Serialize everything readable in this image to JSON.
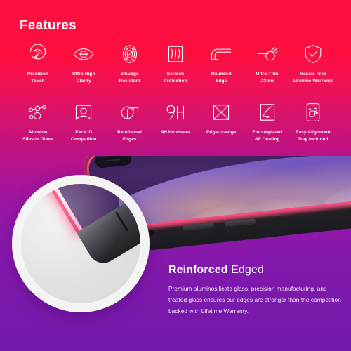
{
  "header": {
    "title": "Features"
  },
  "features": {
    "row1": [
      {
        "label": "Precision\nTouch",
        "icon": "precision-touch-icon"
      },
      {
        "label": "Ultra-High\nClarity",
        "icon": "eye-clarity-icon"
      },
      {
        "label": "Smudge\nResistant",
        "icon": "smudge-resistant-icon"
      },
      {
        "label": "Scratch\nProtection",
        "icon": "scratch-protection-icon"
      },
      {
        "label": "Rounded\nEdge",
        "icon": "rounded-edge-icon"
      },
      {
        "label": "Ultra-Thin\n.33mm",
        "icon": "ultra-thin-caliper-icon"
      },
      {
        "label": "Hassle Free\nLifetime Warranty",
        "icon": "shield-check-icon"
      }
    ],
    "row2": [
      {
        "label": "Alumino\nSilicate Glass",
        "icon": "molecule-icon"
      },
      {
        "label": "Face ID\nCompatible",
        "icon": "face-id-icon"
      },
      {
        "label": "Reinforced\nEdges",
        "icon": "reinforced-edges-icon"
      },
      {
        "label": "9H Hardness",
        "icon": "nine-h-hardness-icon"
      },
      {
        "label": "Edge-to-edge",
        "icon": "edge-to-edge-icon"
      },
      {
        "label": "Electroplated\nAF Coating",
        "icon": "af-coating-icon"
      },
      {
        "label": "Easy Alignment\nTray Included",
        "icon": "alignment-tray-icon"
      }
    ]
  },
  "promo": {
    "heading_bold": "Reinforced",
    "heading_light": "Edged",
    "body": "Premium aluminosilicate glass, precision manufacturing, and treated glass ensures our edges are stronger than the competition backed with Lifetime Warranty."
  },
  "colors": {
    "gradient_top": "#FF0F40",
    "gradient_mid": "#B51580",
    "gradient_bottom": "#7219AB",
    "text_on_dark": "#FFFFFF",
    "rim_glow": "#FF2E67",
    "magnifier_ring": "#F4F4F4"
  }
}
